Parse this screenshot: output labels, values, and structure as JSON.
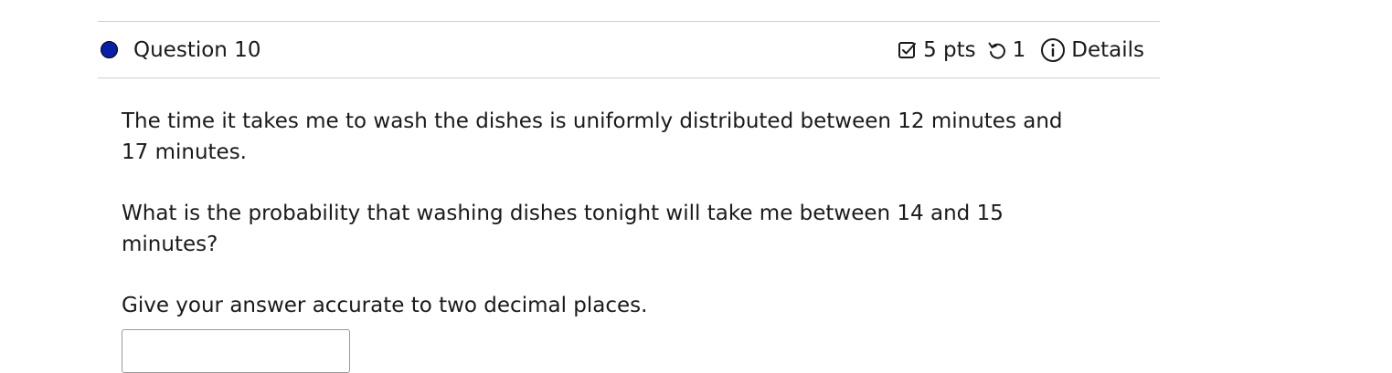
{
  "question": {
    "title": "Question 10",
    "points": "5 pts",
    "attempts": "1",
    "details_label": "Details",
    "status_color": "#0a1fa8",
    "icons": {
      "points": "checkbox-icon",
      "attempts": "undo-icon",
      "details": "info-icon"
    }
  },
  "body": {
    "paragraph_1": "The time it takes me to wash the dishes is uniformly distributed between 12 minutes and 17 minutes.",
    "paragraph_2": "What is the probability that washing dishes tonight will take me between 14 and 15 minutes?",
    "paragraph_3": "Give your answer accurate to two decimal places.",
    "answer_value": ""
  }
}
